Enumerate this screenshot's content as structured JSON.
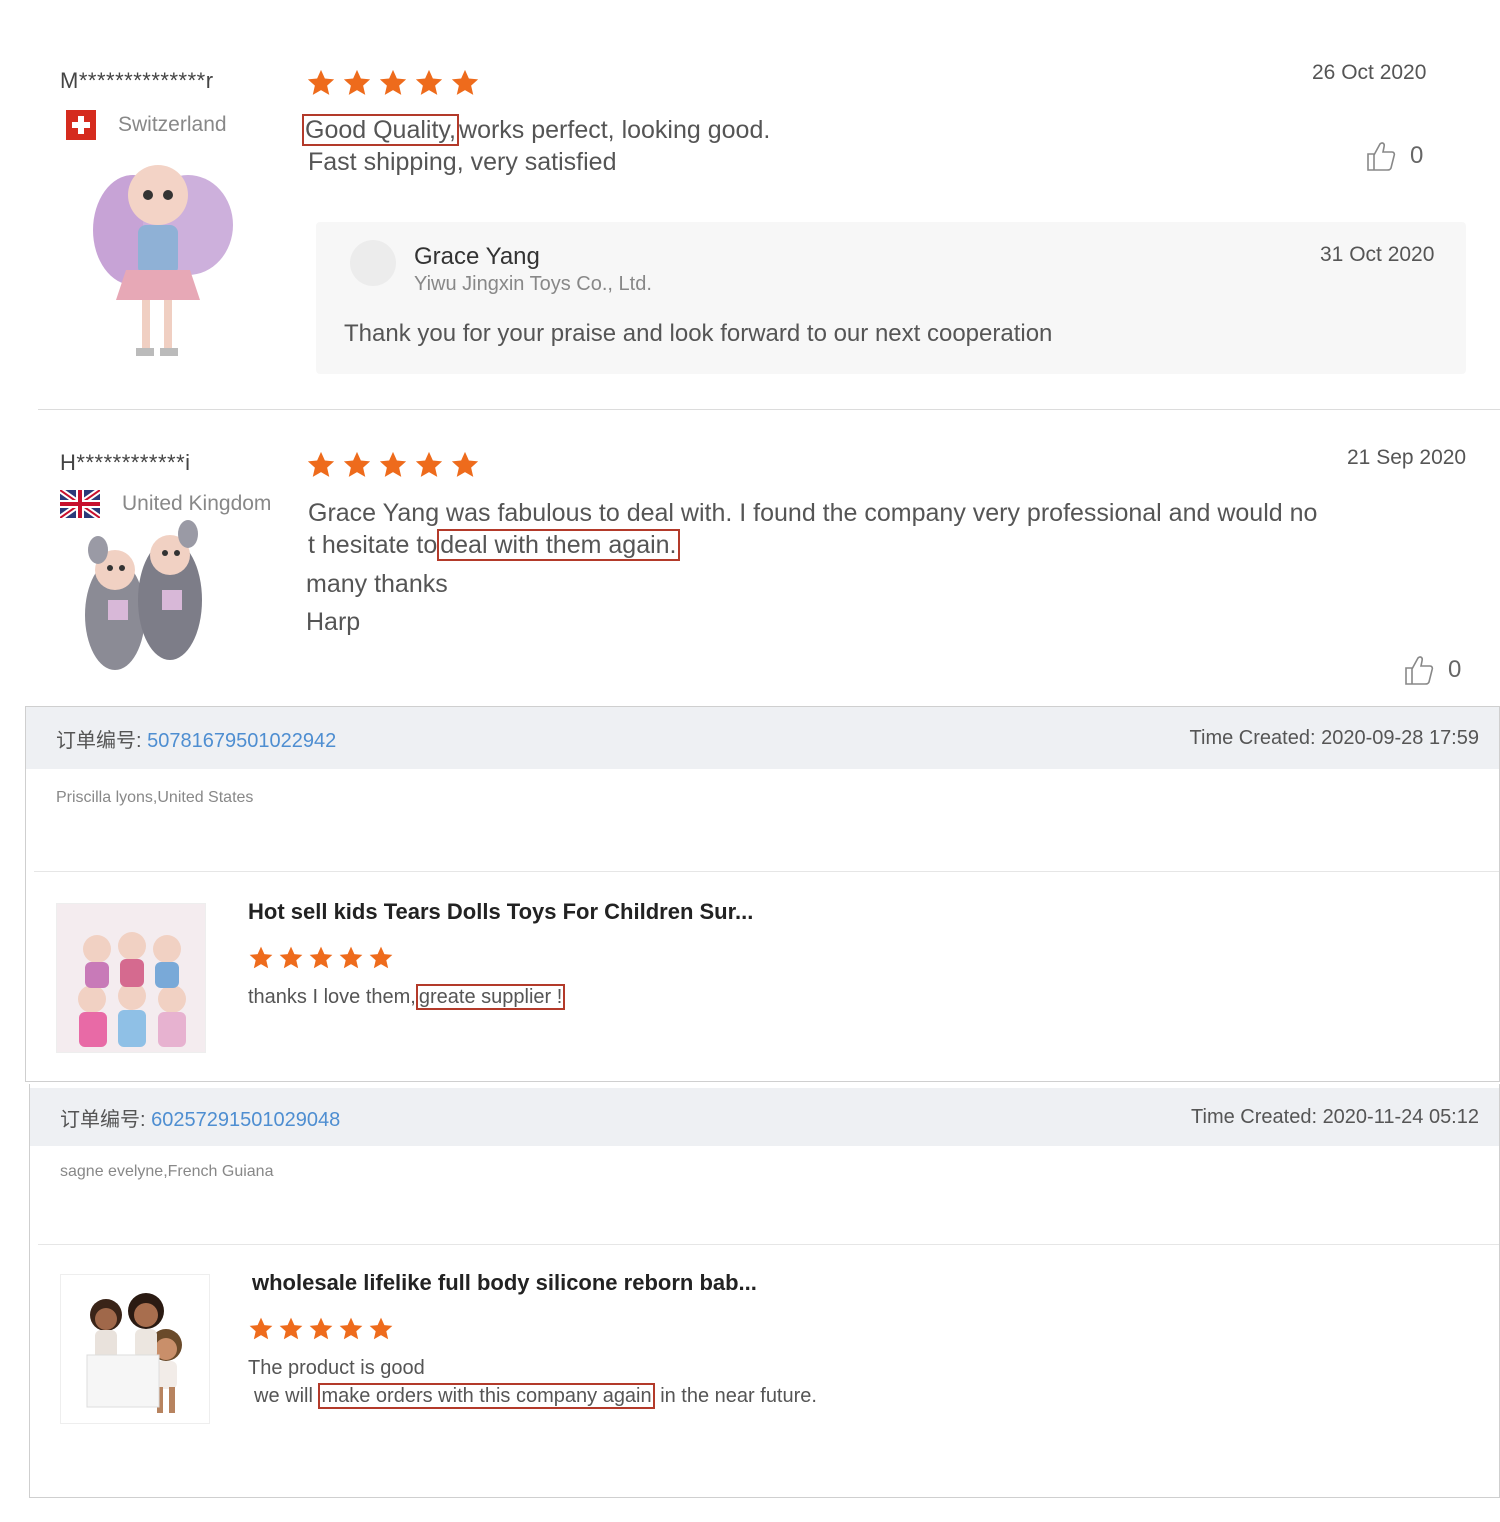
{
  "colors": {
    "star": "#ee6b1c",
    "highlight_box": "#b33a2a",
    "order_id": "#4e8ed1",
    "order_header_bg": "#eef0f3"
  },
  "reviews": [
    {
      "username": "M**************r",
      "country": "Switzerland",
      "flag_icon": "swiss-flag-icon",
      "rating": 5,
      "date": "26 Oct 2020",
      "text_line1_highlight": "Good Quality,",
      "text_line1_rest": "works perfect, looking good.",
      "text_line2": "Fast shipping, very satisfied",
      "likes": "0",
      "reply": {
        "name": "Grace Yang",
        "company": "Yiwu Jingxin Toys Co., Ltd.",
        "date": "31 Oct 2020",
        "text": "Thank you for your praise and look forward to our next cooperation"
      }
    },
    {
      "username": "H************i",
      "country": "United Kingdom",
      "flag_icon": "uk-flag-icon",
      "rating": 5,
      "date": "21 Sep 2020",
      "text_line1": "Grace Yang was fabulous to deal with. I found the company very professional and would no",
      "text_line2_prefix": "t hesitate to",
      "text_line2_highlight": "deal with them again.",
      "text_line3": "many thanks",
      "text_line4": "Harp",
      "likes": "0"
    }
  ],
  "orders": [
    {
      "order_label": "订单编号:",
      "order_id": "50781679501022942",
      "time_label": "Time Created:",
      "time": "2020-09-28 17:59",
      "buyer": "Priscilla lyons,United States",
      "product_title": "Hot sell kids Tears Dolls Toys For Children Sur...",
      "rating": 5,
      "text_prefix": "thanks I love them,",
      "text_highlight": "greate supplier !"
    },
    {
      "order_label": "订单编号:",
      "order_id": "60257291501029048",
      "time_label": "Time Created:",
      "time": "2020-11-24 05:12",
      "buyer": "sagne evelyne,French Guiana",
      "product_title": "wholesale lifelike full body silicone reborn bab...",
      "rating": 5,
      "text_line1": "The product is good",
      "text_line2_prefix": "we will",
      "text_line2_highlight": "make orders with this company again",
      "text_line2_suffix": "in the near future."
    }
  ]
}
